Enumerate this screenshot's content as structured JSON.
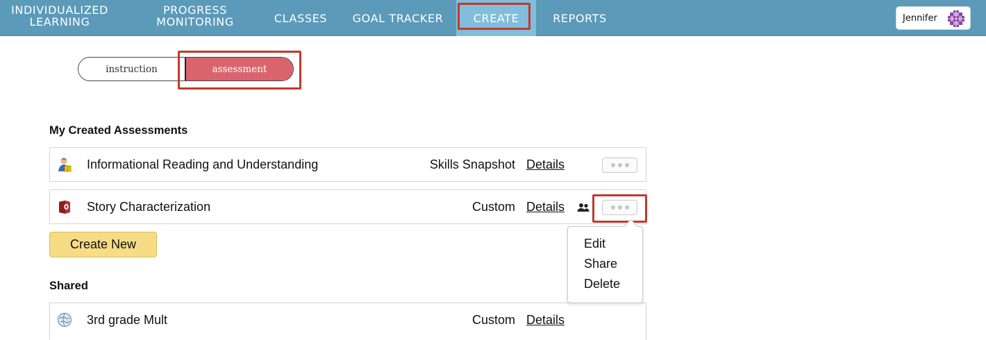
{
  "nav": {
    "individualized": "INDIVIDUALIZED LEARNING",
    "progress": "PROGRESS MONITORING",
    "classes": "CLASSES",
    "goal_tracker": "GOAL TRACKER",
    "create": "CREATE",
    "reports": "REPORTS",
    "active": "CREATE",
    "user_name": "Jennifer",
    "avatar_icon": "purple-quilt-avatar"
  },
  "toggle": {
    "instruction": "instruction",
    "assessment": "assessment",
    "selected": "assessment"
  },
  "my_assessments": {
    "title": "My Created Assessments",
    "rows": [
      {
        "icon": "student-reading-icon",
        "title": "Informational Reading and Understanding",
        "type": "Skills Snapshot",
        "details": "Details",
        "shared": false
      },
      {
        "icon": "red-book-icon",
        "title": "Story Characterization",
        "type": "Custom",
        "details": "Details",
        "shared": true
      }
    ]
  },
  "create_new": "Create New",
  "shared": {
    "title": "Shared",
    "rows": [
      {
        "icon": "globe-icon",
        "title": "3rd grade Mult",
        "type": "Custom",
        "details": "Details"
      }
    ]
  },
  "dropdown": {
    "items": [
      "Edit",
      "Share",
      "Delete"
    ]
  },
  "colors": {
    "nav_bg": "#5b9ab9",
    "nav_active": "#82bddc",
    "highlight_box": "#c0392b",
    "assessment_pill": "#d9646d",
    "create_button": "#f6dc84"
  }
}
